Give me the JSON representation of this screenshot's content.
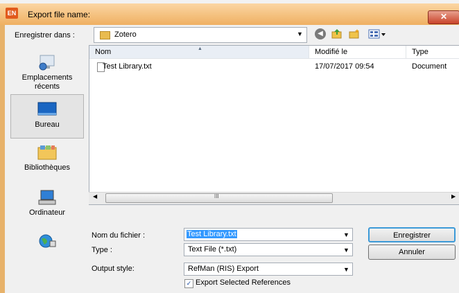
{
  "window": {
    "title": "Export file name:",
    "close_label": "✕",
    "app_badge": "EN"
  },
  "toolbar": {
    "look_in_label": "Enregistrer dans :",
    "look_in_value": "Zotero"
  },
  "places": [
    {
      "label": "Emplacements récents",
      "icon": "recent-places-icon"
    },
    {
      "label": "Bureau",
      "icon": "desktop-icon"
    },
    {
      "label": "Bibliothèques",
      "icon": "libraries-icon"
    },
    {
      "label": "Ordinateur",
      "icon": "computer-icon"
    },
    {
      "label": "",
      "icon": "network-icon"
    }
  ],
  "list": {
    "columns": [
      "Nom",
      "Modifié le",
      "Type"
    ],
    "rows": [
      {
        "name": "Test Library.txt",
        "modified": "17/07/2017 09:54",
        "type": "Document"
      }
    ],
    "scroll_grip": "III"
  },
  "form": {
    "filename_label": "Nom du fichier :",
    "filename_value": "Test Library.txt",
    "type_label": "Type :",
    "type_value": "Text File (*.txt)",
    "output_style_label": "Output style:",
    "output_style_value": "RefMan (RIS) Export",
    "export_selected_label": "Export Selected References",
    "save_label": "Enregistrer",
    "cancel_label": "Annuler"
  },
  "colors": {
    "accent": "#e7b26a",
    "selection": "#3399ff"
  }
}
